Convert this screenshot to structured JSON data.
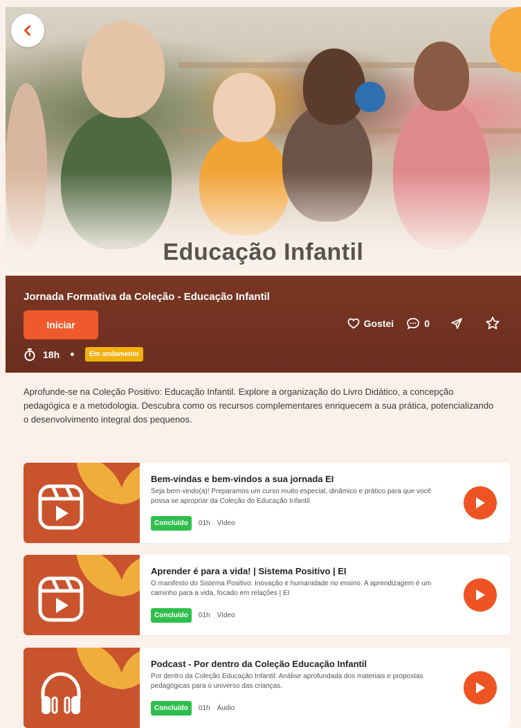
{
  "hero": {
    "title": "Educação Infantil"
  },
  "course": {
    "title": "Jornada Formativa da Coleção - Educação Infantil",
    "start_label": "Iniciar",
    "like_label": "Gostei",
    "comments_count": "0",
    "duration": "18h",
    "status": "Em andamento"
  },
  "description": "Aprofunde-se na Coleção Positivo: Educação Infantil. Explore a organização do Livro Didático, a concepção pedagógica e a metodologia. Descubra como os recursos complementares enriquecem a sua prática, potencializando o desenvolvimento integral dos pequenos.",
  "lessons": [
    {
      "title": "Bem-vindas e bem-vindos a sua jornada EI",
      "subtitle": "Seja bem-vindo(a)! Preparamos um curso muito especial, dinâmico e prático para que você possa se apropriar da Coleção do Educação Infantil",
      "status": "Concluído",
      "duration": "01h",
      "type": "Vídeo",
      "icon": "video-reel-icon"
    },
    {
      "title": "Aprender é para a vida! | Sistema Positivo | EI",
      "subtitle": "O manifesto do Sistema Positivo: Inovação e humanidade no ensino. A aprendizagem é um caminho para a vida, focado em relações | EI",
      "status": "Concluído",
      "duration": "01h",
      "type": "Vídeo",
      "icon": "video-reel-icon"
    },
    {
      "title": "Podcast - Por dentro da Coleção Educação Infantil",
      "subtitle": "Por dentro da Coleção Educação Infantil: Análise aprofundada dos materiais e propostas pedagógicas para o universo das crianças.",
      "status": "Concluído",
      "duration": "01h",
      "type": "Áudio",
      "icon": "headphones-icon"
    }
  ],
  "colors": {
    "accent": "#ef5a2c",
    "band": "#6a2e1f",
    "success": "#2fbe4c",
    "warning": "#f2b10e",
    "thumb": "#c9532d",
    "leaf": "#f0ad3b"
  }
}
